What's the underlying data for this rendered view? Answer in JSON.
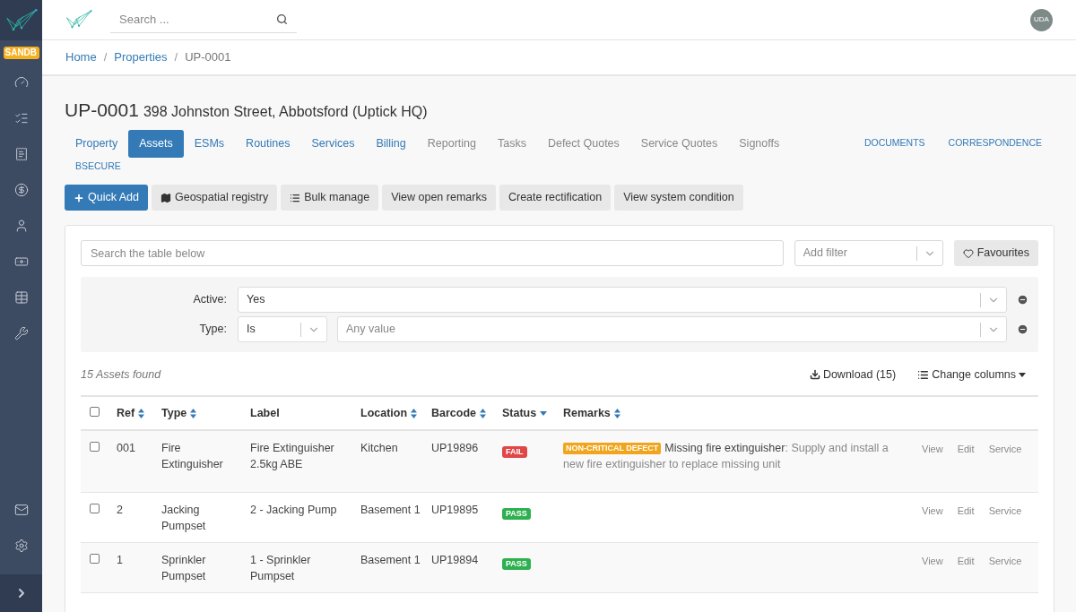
{
  "sidebar": {
    "env_badge": "SANDB"
  },
  "header": {
    "search": {
      "placeholder": "Search ..."
    },
    "avatar": "UDA"
  },
  "breadcrumbs": [
    {
      "label": "Home",
      "current": false
    },
    {
      "label": "Properties",
      "current": false
    },
    {
      "label": "UP-0001",
      "current": true
    }
  ],
  "breadcrumb_separator": "/",
  "title": {
    "code": "UP-0001",
    "address": "398 Johnston Street, Abbotsford (Uptick HQ)"
  },
  "tabs": [
    {
      "label": "Property",
      "kind": "link",
      "selected": false
    },
    {
      "label": "Assets",
      "kind": "link",
      "selected": true
    },
    {
      "label": "ESMs",
      "kind": "link",
      "selected": false
    },
    {
      "label": "Routines",
      "kind": "link",
      "selected": false
    },
    {
      "label": "Services",
      "kind": "link",
      "selected": false
    },
    {
      "label": "Billing",
      "kind": "link",
      "selected": false
    },
    {
      "label": "Reporting",
      "kind": "plain",
      "selected": false
    },
    {
      "label": "Tasks",
      "kind": "plain",
      "selected": false
    },
    {
      "label": "Defect Quotes",
      "kind": "plain",
      "selected": false
    },
    {
      "label": "Service Quotes",
      "kind": "plain",
      "selected": false
    },
    {
      "label": "Signoffs",
      "kind": "plain",
      "selected": false
    }
  ],
  "side_tabs": [
    "DOCUMENTS",
    "CORRESPONDENCE"
  ],
  "extra_tabs": [
    "BSECURE"
  ],
  "actions": [
    {
      "label": "Quick Add",
      "kind": "primary"
    },
    {
      "label": "Geospatial registry",
      "kind": "default"
    },
    {
      "label": "Bulk manage",
      "kind": "default"
    },
    {
      "label": "View open remarks",
      "kind": "default"
    },
    {
      "label": "Create rectification",
      "kind": "default"
    },
    {
      "label": "View system condition",
      "kind": "default"
    }
  ],
  "table_search": {
    "placeholder": "Search the table below"
  },
  "add_filter": {
    "placeholder": "Add filter"
  },
  "favourites": "Favourites",
  "filters": [
    {
      "label": "Active:",
      "value": "Yes"
    },
    {
      "label": "Type:",
      "operator": "Is",
      "placeholder": "Any value"
    }
  ],
  "results_count": "15 Assets found",
  "download": "Download (15)",
  "change_columns": "Change columns",
  "table": {
    "select_all": false,
    "columns": [
      {
        "label": "Ref",
        "kind": "sortable"
      },
      {
        "label": "Type",
        "kind": "sortable"
      },
      {
        "label": "Label",
        "kind": "plain"
      },
      {
        "label": "Location",
        "kind": "sortable"
      },
      {
        "label": "Barcode",
        "kind": "sortable"
      },
      {
        "label": "Status",
        "kind": "sorted"
      },
      {
        "label": "Remarks",
        "kind": "sortable"
      }
    ],
    "rows": [
      {
        "checked": false,
        "ref": "001",
        "type": "Fire Extinguisher",
        "label": "Fire Extinguisher 2.5kg ABE",
        "location": "Kitchen",
        "barcode": "UP19896",
        "status": {
          "label": "FAIL",
          "kind": "fail"
        },
        "remark": {
          "badge": "NON-CRITICAL DEFECT",
          "text": "**Missing fire extinguisher**: Supply and install a new fire extinguisher to replace missing unit"
        },
        "actions": [
          "View",
          "Edit",
          "Service"
        ]
      },
      {
        "checked": false,
        "ref": "2",
        "type": "Jacking Pumpset",
        "label": "2 - Jacking Pump",
        "location": "Basement 1",
        "barcode": "UP19895",
        "status": {
          "label": "PASS",
          "kind": "pass"
        },
        "actions": [
          "View",
          "Edit",
          "Service"
        ]
      },
      {
        "checked": false,
        "ref": "1",
        "type": "Sprinkler Pumpset",
        "label": "1 - Sprinkler Pumpset",
        "location": "Basement 1",
        "barcode": "UP19894",
        "status": {
          "label": "PASS",
          "kind": "pass"
        },
        "actions": [
          "View",
          "Edit",
          "Service"
        ]
      }
    ]
  }
}
